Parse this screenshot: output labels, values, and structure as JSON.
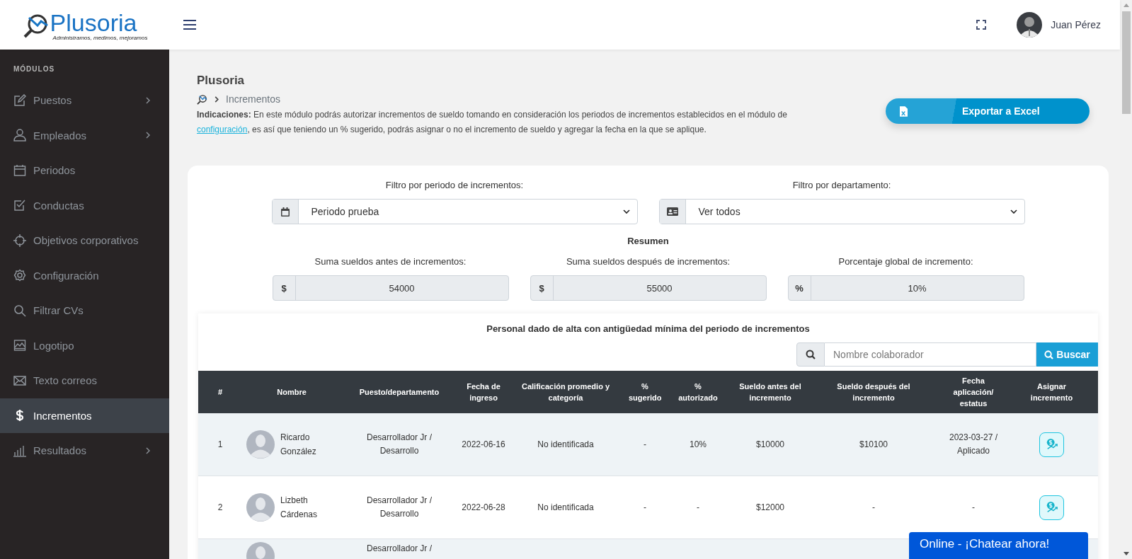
{
  "header": {
    "logo": {
      "name": "Plusoria",
      "tagline": "Administramos, medimos, mejoramos"
    },
    "user": {
      "name": "Juan Pérez"
    }
  },
  "sidebar": {
    "heading": "MÓDULOS",
    "items": [
      {
        "label": "Puestos",
        "has_submenu": true,
        "selected": false
      },
      {
        "label": "Empleados",
        "has_submenu": true,
        "selected": false
      },
      {
        "label": "Periodos",
        "has_submenu": false,
        "selected": false
      },
      {
        "label": "Conductas",
        "has_submenu": false,
        "selected": false
      },
      {
        "label": "Objetivos corporativos",
        "has_submenu": false,
        "selected": false
      },
      {
        "label": "Configuración",
        "has_submenu": false,
        "selected": false
      },
      {
        "label": "Filtrar CVs",
        "has_submenu": false,
        "selected": false
      },
      {
        "label": "Logotipo",
        "has_submenu": false,
        "selected": false
      },
      {
        "label": "Texto correos",
        "has_submenu": false,
        "selected": false
      },
      {
        "label": "Incrementos",
        "has_submenu": false,
        "selected": true
      },
      {
        "label": "Resultados",
        "has_submenu": true,
        "selected": false
      }
    ]
  },
  "page": {
    "title": "Plusoria",
    "breadcrumb": "Incrementos",
    "instructions": {
      "before": "**Indicaciones:** En este módulo podrás autorizar incrementos de sueldo tomando en consideración los periodos de incrementos establecidos en el módulo de",
      "link": "configuración",
      "after": ", es así que teniendo un % sugerido, podrás asignar o no el incremento de sueldo y agregar la fecha en la que se aplique."
    },
    "export_button": "Exportar a Excel"
  },
  "filters": [
    {
      "label": "Filtro por periodo de incrementos:",
      "value": "Periodo prueba"
    },
    {
      "label": "Filtro por departamento:",
      "value": "Ver todos"
    }
  ],
  "summary": {
    "title": "Resumen",
    "fields": [
      {
        "label": "Suma sueldos antes de incrementos:",
        "prefix": "$",
        "value": "54000"
      },
      {
        "label": "Suma sueldos después de incrementos:",
        "prefix": "$",
        "value": "55000"
      },
      {
        "label": "Porcentaje global de incremento:",
        "prefix": "%",
        "value": "10%"
      }
    ]
  },
  "table": {
    "title": "Personal dado de alta con antigüedad mínima del periodo de incrementos",
    "search": {
      "placeholder": "Nombre colaborador",
      "button": "Buscar"
    },
    "columns": [
      "#",
      "Nombre",
      "Puesto/departamento",
      "Fecha de ingreso",
      "Calificación promedio y categoría",
      "% sugerido",
      "% autorizado",
      "Sueldo antes del incremento",
      "Sueldo después del incremento",
      "Fecha aplicación/ estatus",
      "Asignar incremento"
    ],
    "rows": [
      {
        "number": "1",
        "name": "Ricardo González",
        "position": "Desarrollador Jr / Desarrollo",
        "hire_date": "2022-06-16",
        "rating": "No identificada",
        "suggested": "-",
        "authorized": "10%",
        "salary_before": "$10000",
        "salary_after": "$10100",
        "applied": "2023-03-27 / Aplicado"
      },
      {
        "number": "2",
        "name": "Lizbeth Cárdenas",
        "position": "Desarrollador Jr / Desarrollo",
        "hire_date": "2022-06-28",
        "rating": "No identificada",
        "suggested": "-",
        "authorized": "-",
        "salary_before": "$12000",
        "salary_after": "-",
        "applied": "-"
      },
      {
        "position": "Desarrollador Jr /"
      }
    ]
  },
  "chat": {
    "label": "Online - ¡Chatear ahora!"
  }
}
